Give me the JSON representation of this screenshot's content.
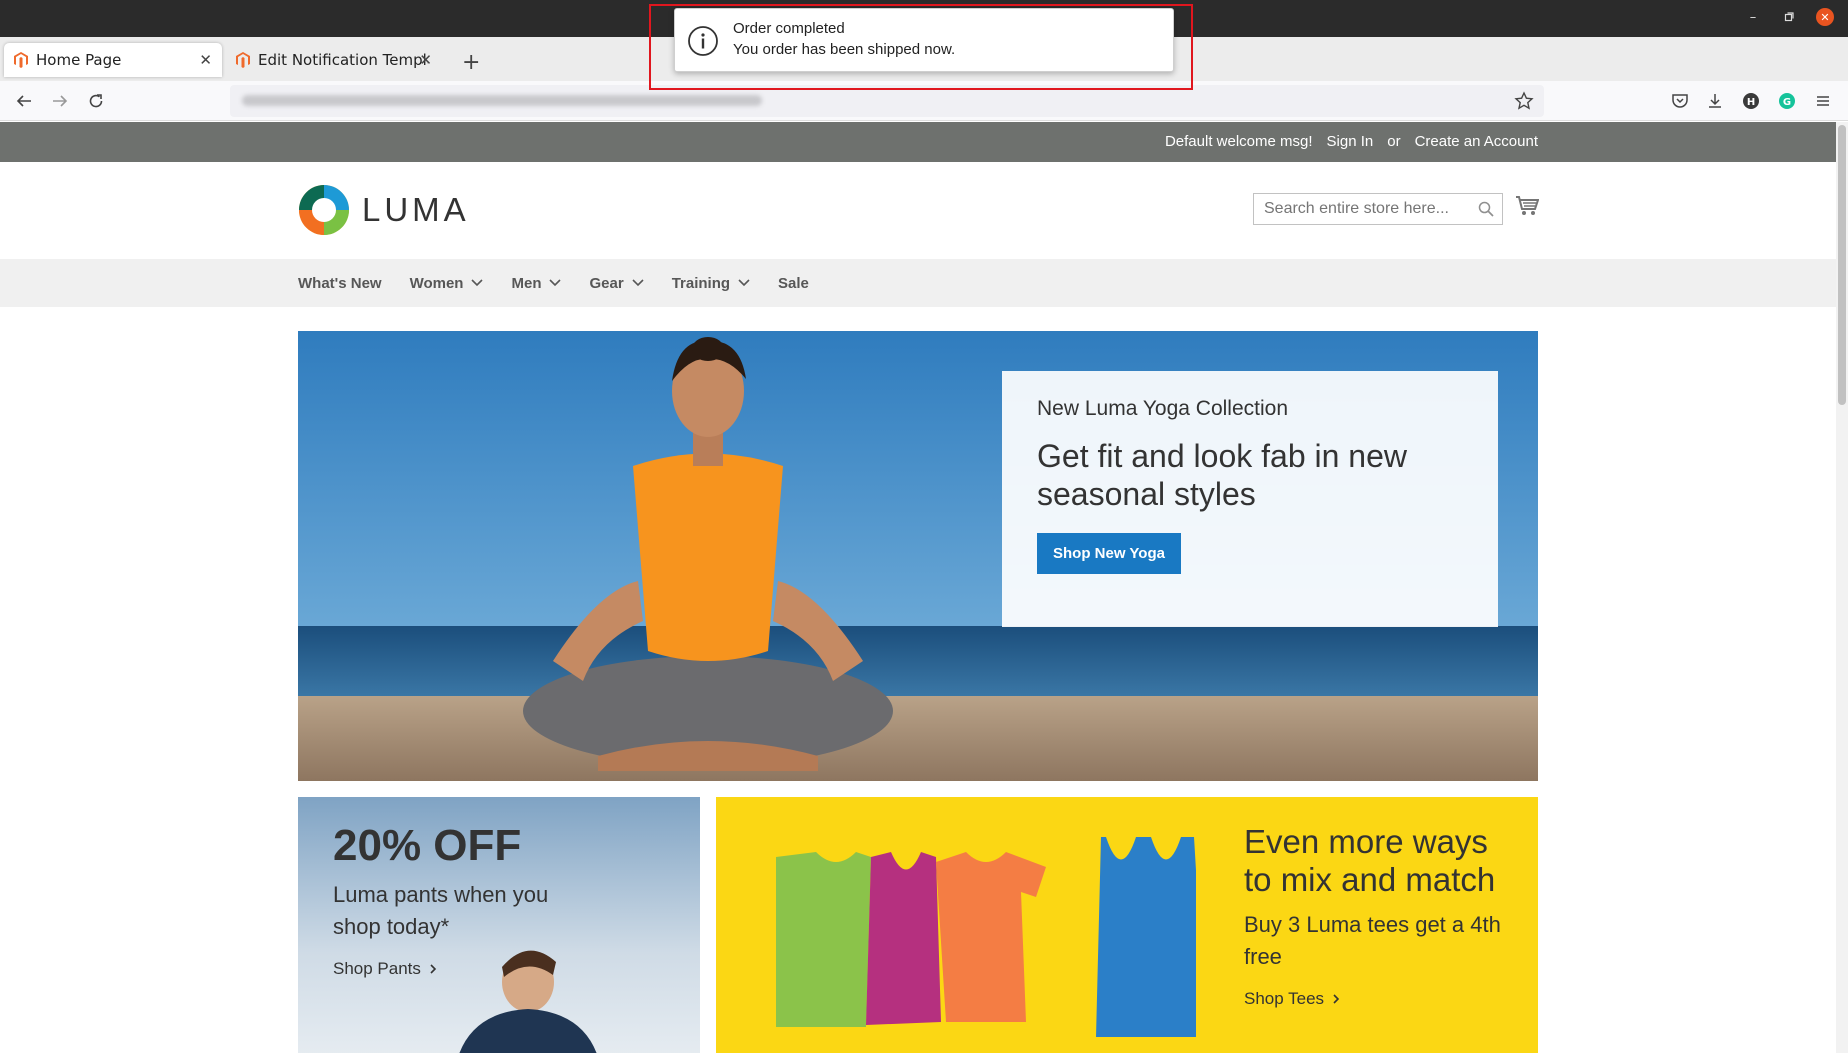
{
  "browser": {
    "tabs": [
      {
        "label": "Home Page",
        "active": true
      },
      {
        "label": "Edit Notification Templat",
        "active": false
      }
    ],
    "new_tab_icon": "plus-icon",
    "window_controls": [
      "minimize",
      "restore",
      "close"
    ]
  },
  "notification": {
    "title": "Order completed",
    "body": "You order has been shipped now.",
    "icon": "info-icon"
  },
  "store": {
    "header": {
      "welcome": "Default welcome msg!",
      "sign_in": "Sign In",
      "or": "or",
      "create_account": "Create an Account"
    },
    "logo_text": "LUMA",
    "search": {
      "placeholder": "Search entire store here..."
    },
    "menu": [
      {
        "label": "What's New",
        "dropdown": false
      },
      {
        "label": "Women",
        "dropdown": true
      },
      {
        "label": "Men",
        "dropdown": true
      },
      {
        "label": "Gear",
        "dropdown": true
      },
      {
        "label": "Training",
        "dropdown": true
      },
      {
        "label": "Sale",
        "dropdown": false
      }
    ],
    "hero": {
      "subtitle": "New Luma Yoga Collection",
      "title": "Get fit and look fab in new seasonal styles",
      "button": "Shop New Yoga"
    },
    "pants_promo": {
      "title": "20% OFF",
      "description": "Luma pants when you shop today*",
      "link": "Shop Pants"
    },
    "tees_promo": {
      "title": "Even more ways to mix and match",
      "description": "Buy 3 Luma tees get a 4th free",
      "link": "Shop Tees"
    }
  },
  "colors": {
    "header_bar": "#6e716e",
    "primary_button": "#1979c3",
    "tees_background": "#fbd714",
    "highlight": "#e0161e"
  }
}
